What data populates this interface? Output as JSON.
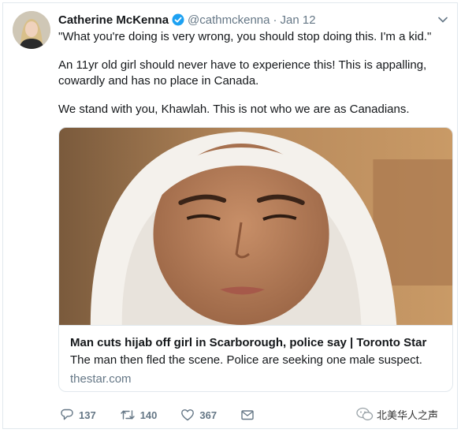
{
  "tweet": {
    "author_name": "Catherine McKenna",
    "handle": "@cathmckenna",
    "separator": "·",
    "date": "Jan 12",
    "paragraphs": [
      "\"What you're doing is very wrong, you should stop doing this. I'm a kid.\"",
      "An 11yr old girl should never have to experience this! This is appalling, cowardly and has no place in Canada.",
      "We stand with you, Khawlah. This is not who we are as Canadians."
    ]
  },
  "card": {
    "title": "Man cuts hijab off girl in Scarborough, police say | Toronto Star",
    "description": "The man then fled the scene. Police are seeking one male suspect.",
    "domain": "thestar.com"
  },
  "actions": {
    "reply_count": "137",
    "retweet_count": "140",
    "like_count": "367"
  },
  "watermark": {
    "text": "北美华人之声"
  },
  "colors": {
    "verified": "#1da1f2",
    "muted": "#657786",
    "text": "#14171a",
    "border": "#e1e8ed"
  },
  "icons": [
    "verified-icon",
    "caret-down-icon",
    "reply-icon",
    "retweet-icon",
    "like-icon",
    "direct-message-icon",
    "wechat-icon"
  ]
}
